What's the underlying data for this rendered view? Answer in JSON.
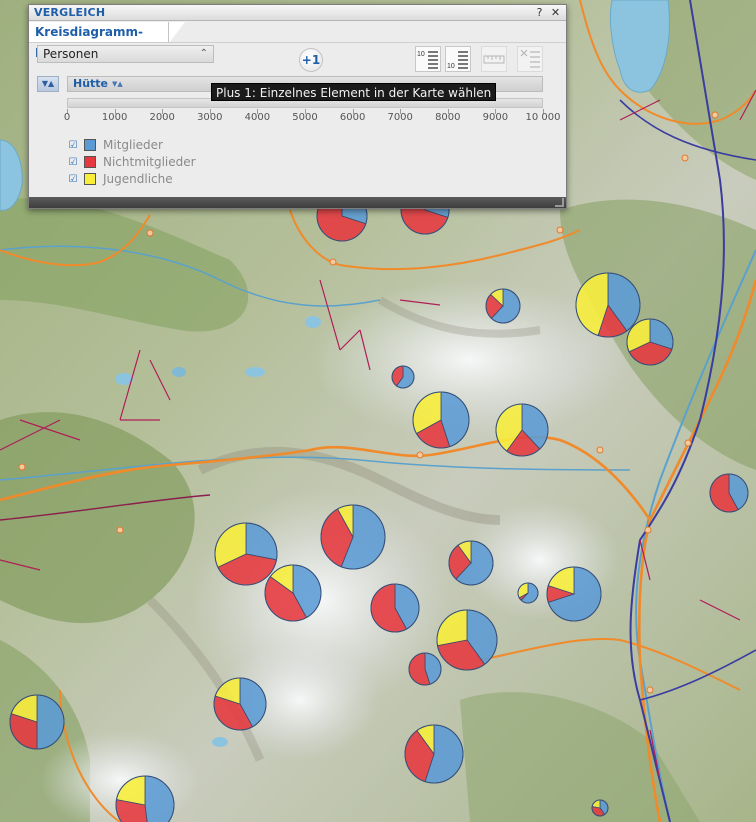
{
  "panel": {
    "title": "VERGLEICH",
    "help_label": "?",
    "close_label": "✕",
    "tab_label": "Kreisdiagramm-Karte",
    "dropdown_value": "Personen",
    "plus_one_label": "+1",
    "tooltip": "Plus 1: Einzelnes Element in der Karte wählen",
    "sort_field": "Hütte",
    "scale_ticks": [
      "0",
      "1000",
      "2000",
      "3000",
      "4000",
      "5000",
      "6000",
      "7000",
      "8000",
      "9000",
      "10 000"
    ],
    "legend": [
      {
        "label": "Mitglieder",
        "color": "#5b9bd5",
        "checked": true
      },
      {
        "label": "Nichtmitglieder",
        "color": "#e6383f",
        "checked": true
      },
      {
        "label": "Jugendliche",
        "color": "#f8ee3a",
        "checked": true
      }
    ],
    "toolbar_icons": [
      "sort-top10-icon",
      "sort-bottom10-icon",
      "ruler-icon",
      "clear-list-icon"
    ]
  },
  "map": {
    "series_colors": {
      "Mitglieder": "#5b9bd5",
      "Nichtmitglieder": "#e6383f",
      "Jugendliche": "#f8ee3a"
    },
    "pie_charts": [
      {
        "members": 0.3,
        "non_members": 0.7,
        "youth": 0.0
      },
      {
        "members": 0.3,
        "non_members": 0.7,
        "youth": 0.0
      },
      {
        "members": 0.62,
        "non_members": 0.25,
        "youth": 0.13
      },
      {
        "members": 0.4,
        "non_members": 0.15,
        "youth": 0.45
      },
      {
        "members": 0.3,
        "non_members": 0.38,
        "youth": 0.32
      },
      {
        "members": 0.6,
        "non_members": 0.4,
        "youth": 0.0
      },
      {
        "members": 0.45,
        "non_members": 0.22,
        "youth": 0.33
      },
      {
        "members": 0.38,
        "non_members": 0.22,
        "youth": 0.4
      },
      {
        "members": 0.42,
        "non_members": 0.58,
        "youth": 0.0
      },
      {
        "members": 0.28,
        "non_members": 0.4,
        "youth": 0.32
      },
      {
        "members": 0.56,
        "non_members": 0.36,
        "youth": 0.08
      },
      {
        "members": 0.62,
        "non_members": 0.28,
        "youth": 0.1
      },
      {
        "members": 0.42,
        "non_members": 0.43,
        "youth": 0.15
      },
      {
        "members": 0.42,
        "non_members": 0.58,
        "youth": 0.0
      },
      {
        "members": 0.62,
        "non_members": 0.05,
        "youth": 0.33
      },
      {
        "members": 0.7,
        "non_members": 0.1,
        "youth": 0.2
      },
      {
        "members": 0.4,
        "non_members": 0.32,
        "youth": 0.28
      },
      {
        "members": 0.45,
        "non_members": 0.55,
        "youth": 0.0
      },
      {
        "members": 0.42,
        "non_members": 0.38,
        "youth": 0.2
      },
      {
        "members": 0.5,
        "non_members": 0.3,
        "youth": 0.2
      },
      {
        "members": 0.55,
        "non_members": 0.35,
        "youth": 0.1
      },
      {
        "members": 0.48,
        "non_members": 0.3,
        "youth": 0.22
      },
      {
        "members": 0.4,
        "non_members": 0.38,
        "youth": 0.22
      }
    ]
  }
}
